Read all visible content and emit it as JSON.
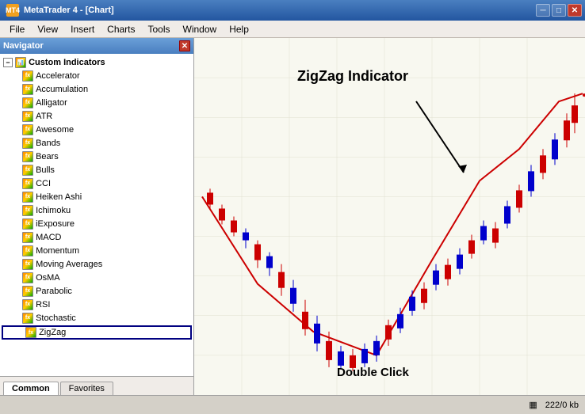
{
  "titlebar": {
    "title": "MetaTrader 4 - [Chart]",
    "icon": "MT4",
    "controls": {
      "minimize": "─",
      "maximize": "□",
      "close": "✕"
    }
  },
  "menubar": {
    "items": [
      "File",
      "View",
      "Insert",
      "Charts",
      "Tools",
      "Window",
      "Help"
    ]
  },
  "navigator": {
    "title": "Navigator",
    "close": "✕",
    "tree": {
      "root_label": "Custom Indicators",
      "items": [
        "Accelerator",
        "Accumulation",
        "Alligator",
        "ATR",
        "Awesome",
        "Bands",
        "Bears",
        "Bulls",
        "CCI",
        "Heiken Ashi",
        "Ichimoku",
        "iExposure",
        "MACD",
        "Momentum",
        "Moving Averages",
        "OsMA",
        "Parabolic",
        "RSI",
        "Stochastic",
        "ZigZag"
      ]
    },
    "tabs": [
      "Common",
      "Favorites"
    ]
  },
  "chart": {
    "annotation_title": "ZigZag Indicator",
    "double_click_label": "Double Click"
  },
  "statusbar": {
    "grid_icon": "▦",
    "memory": "222/0 kb"
  }
}
